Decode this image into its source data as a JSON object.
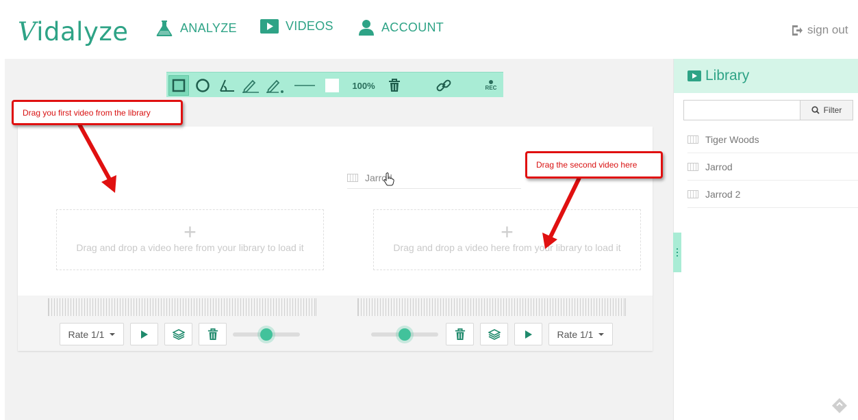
{
  "app": {
    "logo": {
      "first_letter": "V",
      "rest": "idalyze"
    },
    "nav": {
      "analyze": "ANALYZE",
      "videos": "VIDEOS",
      "account": "ACCOUNT"
    },
    "sign_out": "sign out"
  },
  "toolbar": {
    "tools": [
      "rectangle",
      "circle",
      "angle",
      "pencil",
      "pencil-dot",
      "line",
      "color",
      "zoom",
      "delete",
      "link",
      "record"
    ],
    "zoom": "100%",
    "rec_label": "REC",
    "fill_color": "#ffffff"
  },
  "dropzones": {
    "left": {
      "text": "Drag and drop a video here from your library to load it"
    },
    "right": {
      "text": "Drag and drop a video here from your library to load it"
    }
  },
  "players": {
    "left": {
      "rate": "Rate 1/1",
      "slider_value": 0.5
    },
    "right": {
      "rate": "Rate 1/1",
      "slider_value": 0.5
    }
  },
  "drag_ghost": {
    "label": "Jarrod"
  },
  "annotations": {
    "first": "Drag you first video from the library",
    "second": "Drag the second video here"
  },
  "library": {
    "title": "Library",
    "search": {
      "value": "",
      "placeholder": ""
    },
    "filter_label": "Filter",
    "items": [
      {
        "label": "Tiger Woods"
      },
      {
        "label": "Jarrod"
      },
      {
        "label": "Jarrod 2"
      }
    ]
  },
  "colors": {
    "accent": "#2ea386",
    "toolbar_bg": "#a9ecd5",
    "annotation_red": "#e01010"
  }
}
